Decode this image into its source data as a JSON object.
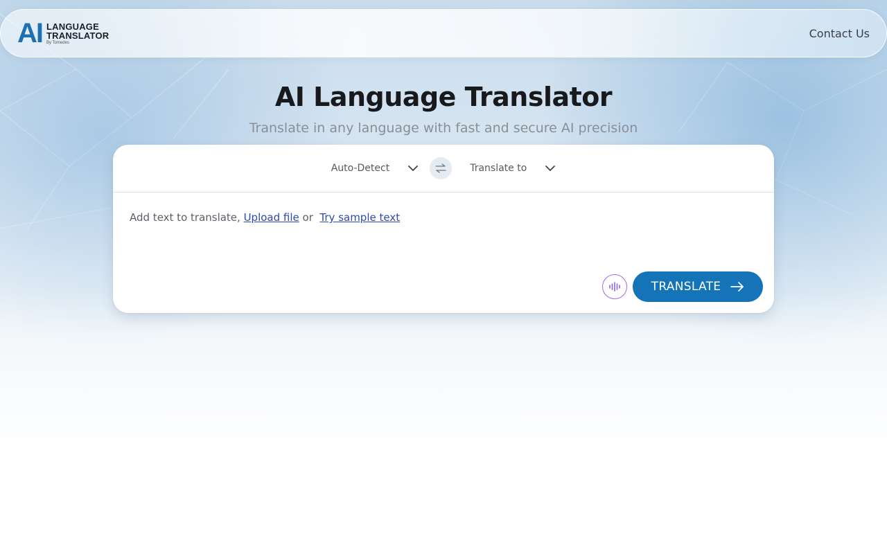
{
  "header": {
    "logo_mark": "AI",
    "logo_line1": "LANGUAGE",
    "logo_line2": "TRANSLATOR",
    "logo_by": "By Tomedes",
    "contact_label": "Contact Us"
  },
  "hero": {
    "title": "AI Language Translator",
    "subtitle": "Translate in any language with fast and secure AI precision"
  },
  "translator": {
    "source_lang": "Auto-Detect",
    "target_lang": "Translate to",
    "prompt_text": "Add text to translate, ",
    "upload_link": "Upload file",
    "or_text": " or ",
    "sample_link": "Try sample text",
    "translate_label": "TRANSLATE"
  },
  "icons": {
    "swap": "swap-arrows-icon",
    "chevron": "chevron-down-icon",
    "mic": "audio-wave-icon",
    "arrow": "arrow-right-icon"
  },
  "colors": {
    "accent": "#1574b7",
    "link": "#2f48b4",
    "mic_border": "#9b6be6",
    "logo_blue": "#1f6fb3"
  }
}
